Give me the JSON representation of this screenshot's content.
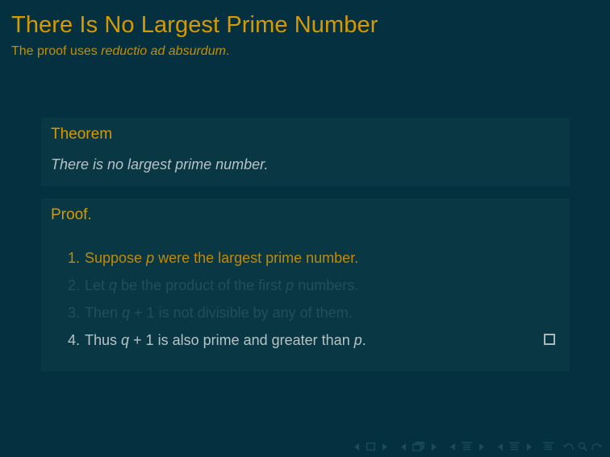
{
  "slide": {
    "title": "There Is No Largest Prime Number",
    "subtitle_prefix": "The proof uses ",
    "subtitle_italic": "reductio ad absurdum",
    "subtitle_suffix": "."
  },
  "theorem": {
    "block_title": "Theorem",
    "statement": "There is no largest prime number."
  },
  "proof": {
    "block_title": "Proof.",
    "items": [
      {
        "number": "1.",
        "text": "Suppose p were the largest prime number.",
        "state": "alerted"
      },
      {
        "number": "2.",
        "text": "Let q be the product of the first p numbers.",
        "state": "covered"
      },
      {
        "number": "3.",
        "text": "Then q + 1 is not divisible by any of them.",
        "state": "covered"
      },
      {
        "number": "4.",
        "text": "Thus q + 1 is also prime and greater than p.",
        "state": "active"
      }
    ],
    "qed_symbol": "qed-box"
  },
  "navigation": {
    "groups": [
      {
        "name": "slide-navigation",
        "prev": "triangle-left-icon",
        "center": "square-icon",
        "next": "triangle-right-icon"
      },
      {
        "name": "frame-navigation",
        "prev": "triangle-left-icon",
        "center": "stacked-frames-icon",
        "next": "triangle-right-icon"
      },
      {
        "name": "subsection-navigation",
        "prev": "triangle-left-icon",
        "center": "subsection-lines-icon",
        "next": "triangle-right-icon"
      },
      {
        "name": "section-navigation",
        "prev": "triangle-left-icon",
        "center": "section-lines-icon",
        "next": "triangle-right-icon"
      }
    ],
    "document_icon": "document-lines-icon",
    "back_icon": "undo-arrow-icon",
    "search_icon": "search-icon",
    "forward_icon": "redo-arrow-icon"
  },
  "colors": {
    "background": "#05303f",
    "block_background": "#0a3744",
    "title_gold": "#d69a00",
    "subtitle_gold": "#c28f05",
    "alerted_gold": "#c08a06",
    "active_text": "#b6c3c6",
    "covered_text": "#20505c",
    "nav_symbol": "#1d4c58"
  }
}
